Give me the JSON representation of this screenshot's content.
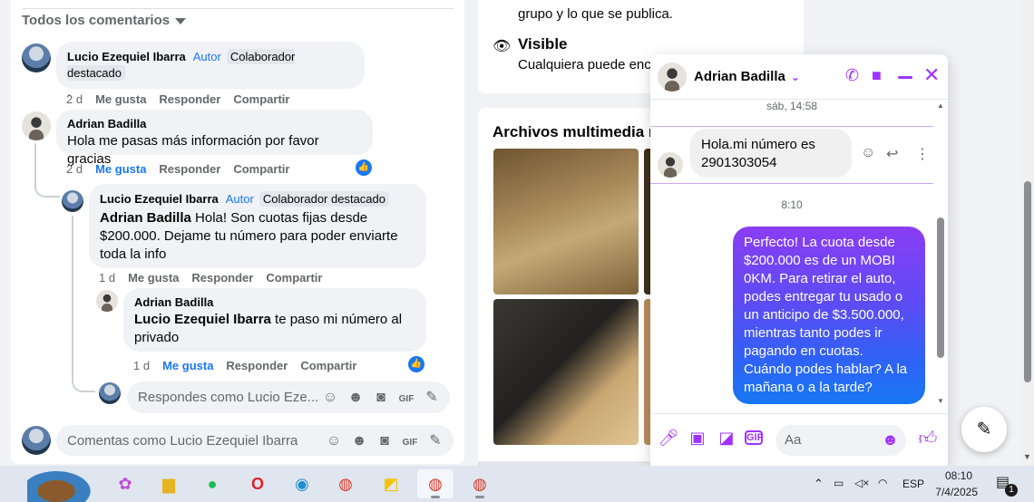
{
  "comments": {
    "filter_label": "Todos los comentarios",
    "items": [
      {
        "name": "Lucio Ezequiel Ibarra",
        "author_badge": "Autor",
        "badge": "Colaborador destacado",
        "text": ".",
        "time": "2 d",
        "like": "Me gusta",
        "reply": "Responder",
        "share": "Compartir"
      },
      {
        "name": "Adrian Badilla",
        "text": "Hola me pasas más información por favor gracias",
        "time": "2 d",
        "like": "Me gusta",
        "reply": "Responder",
        "share": "Compartir"
      },
      {
        "name": "Lucio Ezequiel Ibarra",
        "author_badge": "Autor",
        "badge": "Colaborador destacado",
        "mention": "Adrian Badilla",
        "text": " Hola! Son cuotas fijas desde $200.000. Dejame tu número para poder enviarte toda la info",
        "time": "1 d",
        "like": "Me gusta",
        "reply": "Responder",
        "share": "Compartir"
      },
      {
        "name": "Adrian Badilla",
        "mention": "Lucio Ezequiel Ibarra",
        "text": " te paso mi número al privado",
        "time": "1 d",
        "like": "Me gusta",
        "reply": "Responder",
        "share": "Compartir"
      }
    ],
    "reply_placeholder": "Respondes como Lucio Eze...",
    "comment_placeholder": "Comentas como Lucio Ezequiel Ibarra"
  },
  "group_info": {
    "line1": "grupo y lo que se publica.",
    "visible_title": "Visible",
    "visible_desc": "Cualquiera puede enco",
    "media_title": "Archivos multimedia re"
  },
  "chat": {
    "contact_name": "Adrian Badilla",
    "timestamp1": "sáb, 14:58",
    "incoming": "Hola.mi número es 2901303054",
    "timestamp2": "8:10",
    "outgoing": "Perfecto! La cuota desde $200.000 es de un MOBI 0KM. Para retirar el auto, podes entregar tu usado o un anticipo de $3.500.000, mientras tanto podes ir pagando en cuotas. Cuándo podes hablar? A la mañana o a la tarde?",
    "input_placeholder": "Aa",
    "accent_color": "#a033ff"
  },
  "taskbar": {
    "language": "ESP",
    "time": "08:10",
    "date": "7/4/2025",
    "notification_count": "1"
  }
}
